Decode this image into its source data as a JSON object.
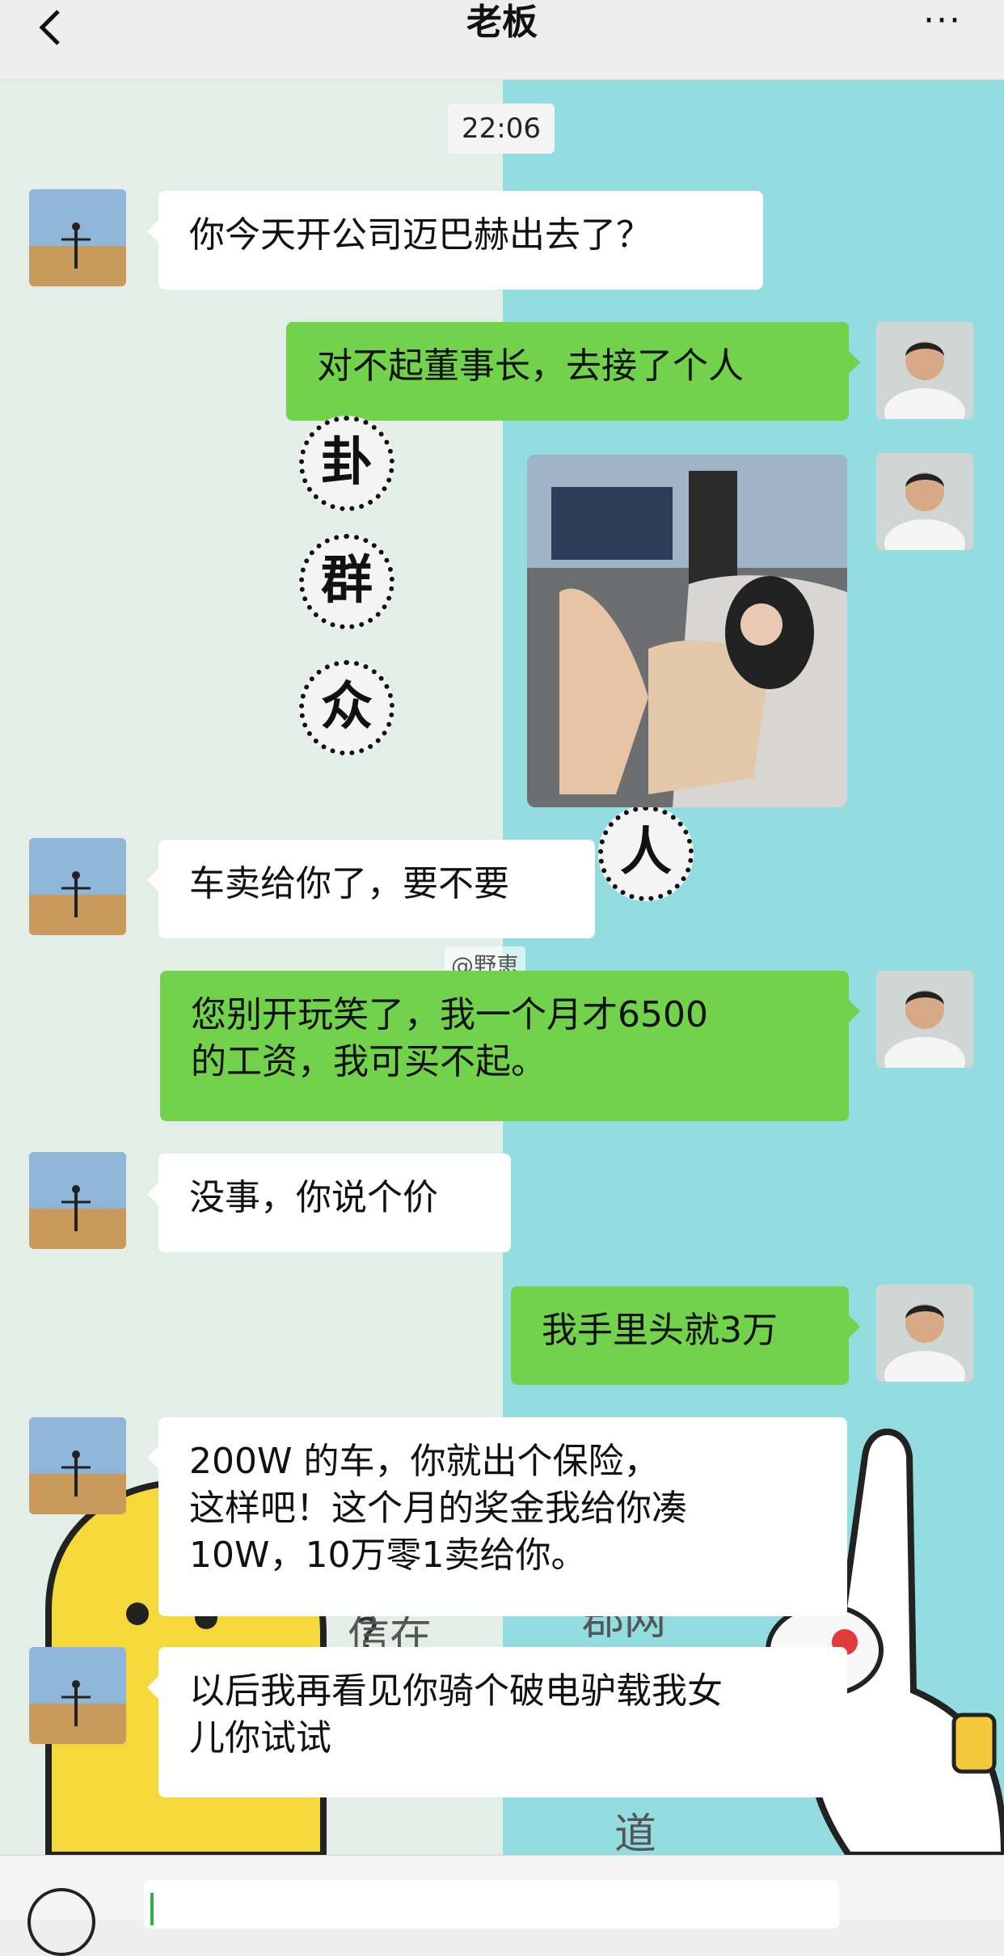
{
  "header": {
    "title": "老板",
    "back_icon": "chevron-left-icon",
    "more_icon": "more-dots-icon",
    "more_label": "···"
  },
  "timestamp": "22:06",
  "watermark": "@野恵",
  "messages": [
    {
      "from": "boss",
      "text": "你今天开公司迈巴赫出去了？"
    },
    {
      "from": "me",
      "text": "对不起董事长，去接了个人"
    },
    {
      "from": "me",
      "type": "image",
      "icon": "photo-woman-in-car"
    },
    {
      "from": "boss",
      "text": "车卖给你了，要不要"
    },
    {
      "from": "me",
      "text": "您别开玩笑了，我一个月才6500\n的工资，我可买不起。"
    },
    {
      "from": "boss",
      "text": "没事，你说个价"
    },
    {
      "from": "me",
      "text": "我手里头就3万"
    },
    {
      "from": "boss",
      "text": "200W 的车，你就出个保险，\n这样吧！这个月的奖金我给你凑\n10W，10万零1卖给你。"
    },
    {
      "from": "boss",
      "text": "以后我再看见你骑个破电驴载我女\n儿你试试"
    }
  ],
  "sticker_left": [
    "卦",
    "群",
    "众"
  ],
  "sticker_right": [
    "人"
  ],
  "colors": {
    "outgoing_bubble": "#72d24c",
    "incoming_bubble": "#ffffff",
    "wallpaper_right": "#93dce0",
    "wallpaper_left": "#e4eee9"
  }
}
